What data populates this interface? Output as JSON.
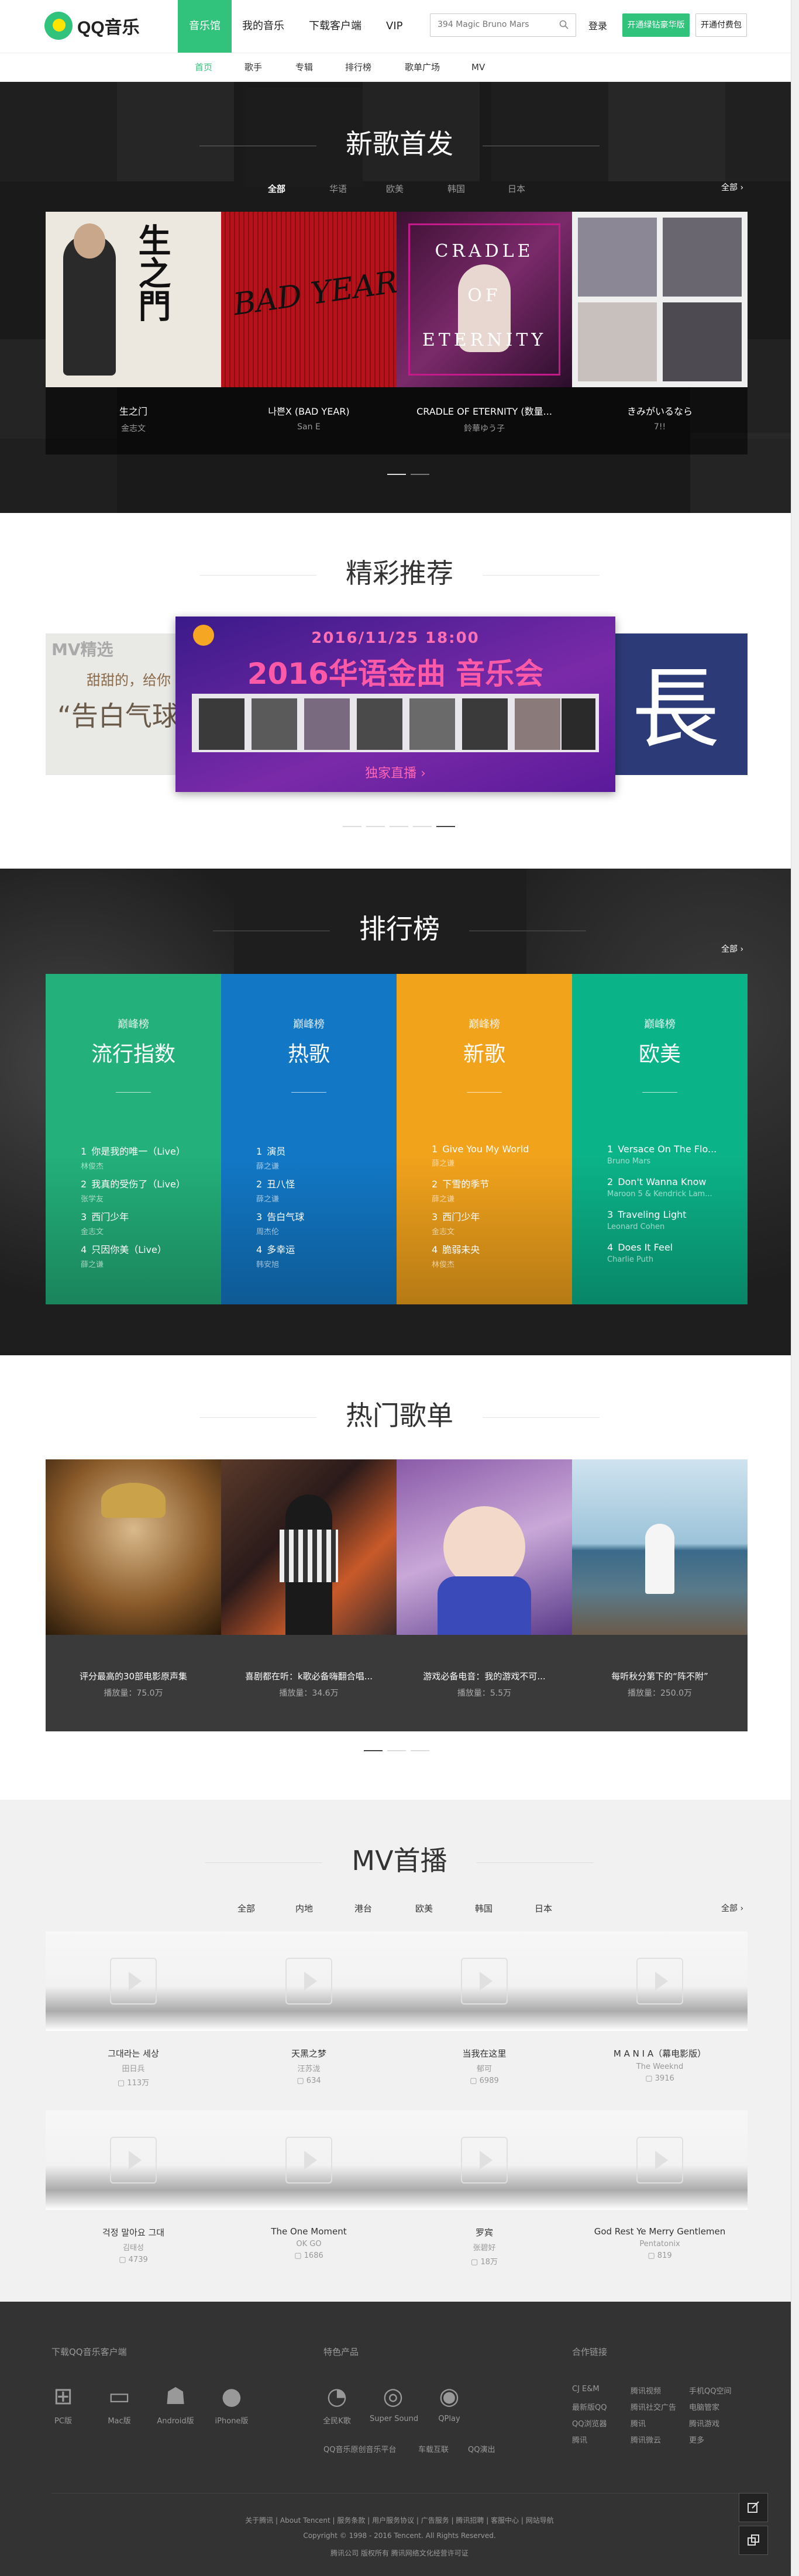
{
  "header": {
    "logo_text": "QQ音乐",
    "nav": [
      "音乐馆",
      "我的音乐",
      "下载客户端",
      "VIP"
    ],
    "search_placeholder": "394 Magic Bruno Mars",
    "login": "登录",
    "vip_button": "开通绿钻豪华版",
    "pay_button": "开通付费包"
  },
  "subnav": [
    "首页",
    "歌手",
    "专辑",
    "排行榜",
    "歌单广场",
    "MV"
  ],
  "new_songs": {
    "title": "新歌首发",
    "tabs": [
      "全部",
      "华语",
      "欧美",
      "韩国",
      "日本"
    ],
    "all": "全部 ›",
    "cards": [
      {
        "title": "生之门",
        "artist": "金志文",
        "art_text": "生之門"
      },
      {
        "title": "나쁜X (BAD YEAR)",
        "artist": "San E",
        "art_text": "BAD YEAR"
      },
      {
        "title": "CRADLE OF ETERNITY (数量...",
        "artist": "鈴華ゆう子",
        "art_text": "CRADLE OF ETERNITY"
      },
      {
        "title": "きみがいるなら",
        "artist": "7!!"
      }
    ]
  },
  "featured": {
    "title": "精彩推荐",
    "left_banner_text": "MV精选",
    "left_banner_sub": "甜甜的，给你",
    "left_banner_big": "“告白气球",
    "center_date": "2016/11/25 18:00",
    "center_title": "2016华语金曲 音乐会",
    "center_button": "独家直播 ›",
    "right_banner_text": "長"
  },
  "ranking": {
    "title": "排行榜",
    "all": "全部 ›",
    "charts": [
      {
        "caption": "巅峰榜",
        "name": "流行指数",
        "color": "#23b07a",
        "songs": [
          {
            "n": "1",
            "song": "你是我的唯一（Live）",
            "artist": "林俊杰"
          },
          {
            "n": "2",
            "song": "我真的受伤了（Live）",
            "artist": "张学友"
          },
          {
            "n": "3",
            "song": "西门少年",
            "artist": "金志文"
          },
          {
            "n": "4",
            "song": "只因你美（Live）",
            "artist": "薛之谦"
          }
        ]
      },
      {
        "caption": "巅峰榜",
        "name": "热歌",
        "color": "#1278c6",
        "songs": [
          {
            "n": "1",
            "song": "演员",
            "artist": "薛之谦"
          },
          {
            "n": "2",
            "song": "丑八怪",
            "artist": "薛之谦"
          },
          {
            "n": "3",
            "song": "告白气球",
            "artist": "周杰伦"
          },
          {
            "n": "4",
            "song": "多幸运",
            "artist": "韩安旭"
          }
        ]
      },
      {
        "caption": "巅峰榜",
        "name": "新歌",
        "color": "#f2a31c",
        "songs": [
          {
            "n": "1",
            "song": "Give You My World",
            "artist": "薛之谦"
          },
          {
            "n": "2",
            "song": "下雪的季节",
            "artist": "薛之谦"
          },
          {
            "n": "3",
            "song": "西门少年",
            "artist": "金志文"
          },
          {
            "n": "4",
            "song": "脆弱未央",
            "artist": "林俊杰"
          }
        ]
      },
      {
        "caption": "巅峰榜",
        "name": "欧美",
        "color": "#0bb389",
        "songs": [
          {
            "n": "1",
            "song": "Versace On The Flo...",
            "artist": "Bruno Mars"
          },
          {
            "n": "2",
            "song": "Don't Wanna Know",
            "artist": "Maroon 5 & Kendrick Lam..."
          },
          {
            "n": "3",
            "song": "Traveling Light",
            "artist": "Leonard Cohen"
          },
          {
            "n": "4",
            "song": "Does It Feel",
            "artist": "Charlie Puth"
          }
        ]
      }
    ]
  },
  "playlists": {
    "title": "热门歌单",
    "items": [
      {
        "title": "评分最高的30部电影原声集",
        "count": "播放量：75.0万"
      },
      {
        "title": "喜剧都在听：k歌必备嗨翻合唱...",
        "count": "播放量：34.6万"
      },
      {
        "title": "游戏必备电音：我的游戏不可...",
        "count": "播放量：5.5万"
      },
      {
        "title": "每听秋分第下的“阵不附”",
        "count": "播放量：250.0万"
      }
    ]
  },
  "mv": {
    "title": "MV首播",
    "tabs": [
      "全部",
      "内地",
      "港台",
      "欧美",
      "韩国",
      "日本"
    ],
    "all": "全部 ›",
    "items": [
      {
        "title": "그대라는 세상",
        "artist": "田日兵",
        "views": "113万"
      },
      {
        "title": "天黑之梦",
        "artist": "汪苏泷",
        "views": "634"
      },
      {
        "title": "当我在这里",
        "artist": "郁可",
        "views": "6989"
      },
      {
        "title": "M A N I A（幕电影版）",
        "artist": "The Weeknd",
        "views": "3916"
      },
      {
        "title": "걱정 말아요 그대",
        "artist": "김태성",
        "views": "4739"
      },
      {
        "title": "The One Moment",
        "artist": "OK GO",
        "views": "1686"
      },
      {
        "title": "罗宾",
        "artist": "张碧好",
        "views": "18万"
      },
      {
        "title": "God Rest Ye Merry Gentlemen",
        "artist": "Pentatonix",
        "views": "819"
      }
    ]
  },
  "footer": {
    "download_title": "下载QQ音乐客户端",
    "downloads": [
      {
        "label": "PC版",
        "icon": "windows-icon",
        "glyph": "⊞"
      },
      {
        "label": "Mac版",
        "icon": "mac-icon",
        "glyph": "▭"
      },
      {
        "label": "Android版",
        "icon": "android-icon",
        "glyph": "☗"
      },
      {
        "label": "iPhone版",
        "icon": "apple-icon",
        "glyph": "●"
      }
    ],
    "products_title": "特色产品",
    "products": [
      {
        "label": "全民K歌",
        "icon": "kge-icon",
        "glyph": "◔"
      },
      {
        "label": "Super Sound",
        "icon": "supersound-icon",
        "glyph": "◎"
      },
      {
        "label": "QPlay",
        "icon": "qplay-icon",
        "glyph": "◉"
      }
    ],
    "product_links": [
      "QQ音乐原创音乐平台",
      "车载互联",
      "QQ演出"
    ],
    "partner_title": "合作链接",
    "partners": [
      [
        "CJ E&M",
        "腾讯视频",
        "手机QQ空间"
      ],
      [
        "最新版QQ",
        "腾讯社交广告",
        "电脑管家"
      ],
      [
        "QQ浏览器",
        "腾讯",
        "腾讯游戏"
      ],
      [
        "腾讯",
        "腾讯微云",
        "更多"
      ]
    ],
    "links": "关于腾讯 | About Tencent | 服务条款 | 用户服务协议 | 广告服务 | 腾讯招聘 | 客服中心 | 网站导航",
    "copyright": "Copyright © 1998 - 2016 Tencent. All Rights Reserved.",
    "icp": "腾讯公司 版权所有 腾讯网络文化经营许可证"
  }
}
